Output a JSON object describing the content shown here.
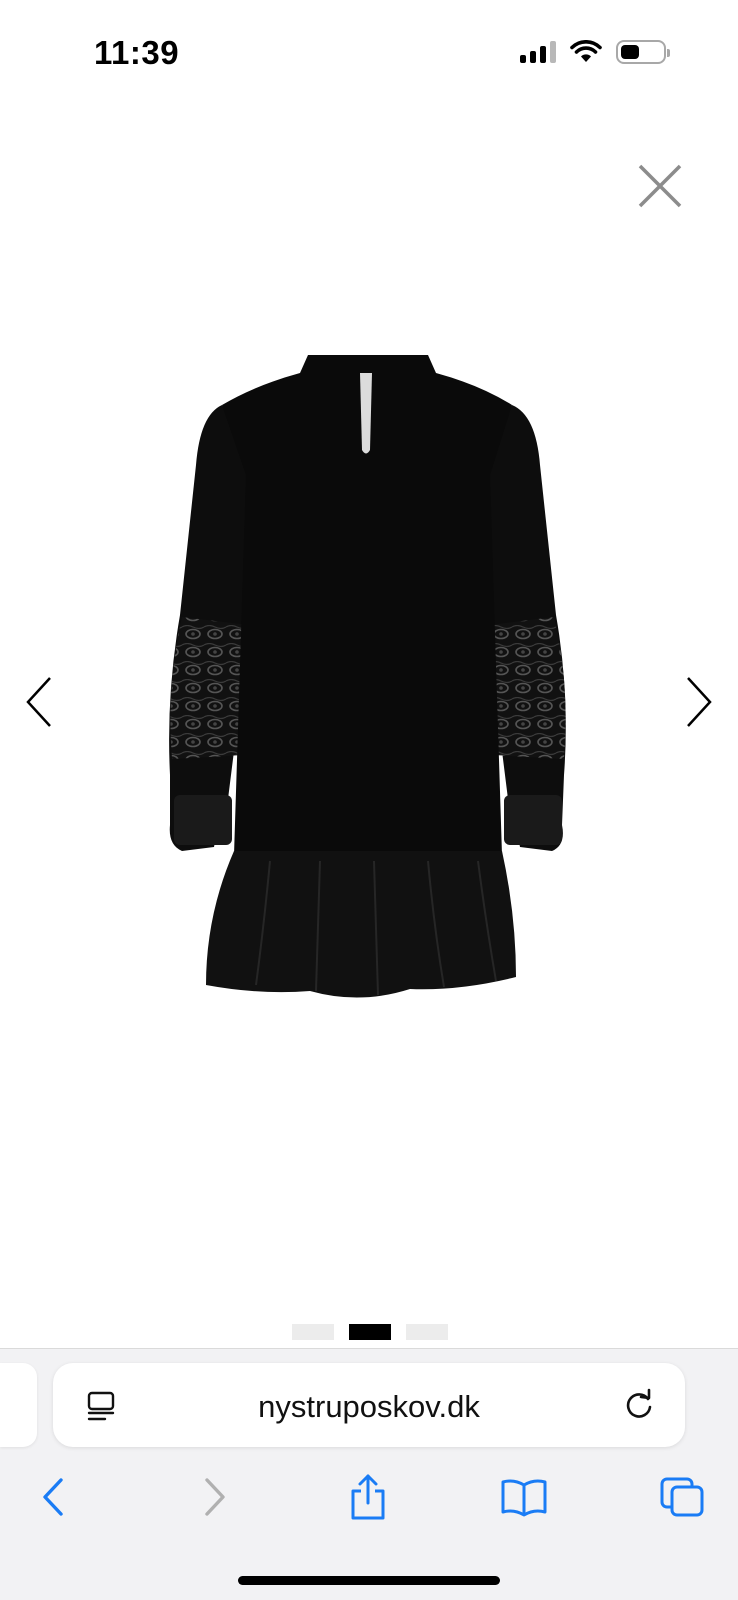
{
  "status_bar": {
    "time": "11:39"
  },
  "gallery": {
    "image_alt": "Black long-sleeve dress with lace sleeve panels and ruffled hem, back view",
    "current_index": 2,
    "total_images": 3
  },
  "browser": {
    "address": "nystruposkov.dk"
  },
  "colors": {
    "accent": "#1a7cf5",
    "disabled": "#b0b0b0"
  }
}
